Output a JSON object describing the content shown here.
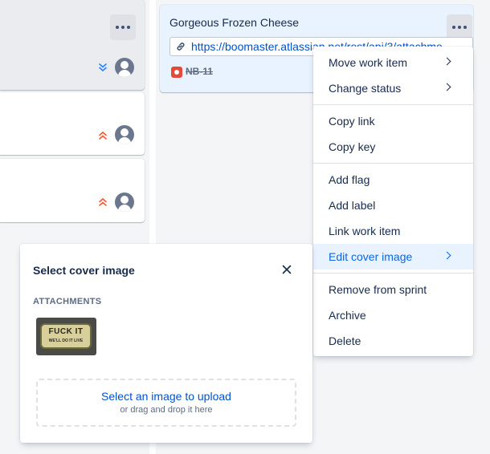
{
  "board": {
    "left_cards": [
      {
        "priority": "lowest",
        "priority_color": "#2684ff"
      },
      {
        "priority": "highest",
        "priority_color": "#ff5630"
      },
      {
        "priority": "highest",
        "priority_color": "#ff5630"
      }
    ]
  },
  "card": {
    "title": "Gorgeous Frozen Cheese",
    "link": "https://boomaster.atlassian.net/rest/api/3/attachme",
    "issue_key": "NB-11",
    "issue_type_color": "#e5493a"
  },
  "context_menu": {
    "groups": [
      [
        {
          "label": "Move work item",
          "submenu": true
        },
        {
          "label": "Change status",
          "submenu": true
        }
      ],
      [
        {
          "label": "Copy link"
        },
        {
          "label": "Copy key"
        }
      ],
      [
        {
          "label": "Add flag"
        },
        {
          "label": "Add label"
        },
        {
          "label": "Link work item"
        },
        {
          "label": "Edit cover image",
          "submenu": true,
          "active": true
        }
      ],
      [
        {
          "label": "Remove from sprint"
        },
        {
          "label": "Archive"
        },
        {
          "label": "Delete"
        }
      ]
    ]
  },
  "dialog": {
    "title": "Select cover image",
    "section_label": "ATTACHMENTS",
    "thumbnail_text_line1": "FUCK IT",
    "thumbnail_text_line2": "WE'LL DO IT LIVE",
    "upload_label": "Select an image to upload",
    "upload_hint": "or drag and drop it here"
  },
  "colors": {
    "accent": "#0c66e4",
    "link": "#0052cc",
    "selected_card_bg": "#e9f2ff"
  }
}
